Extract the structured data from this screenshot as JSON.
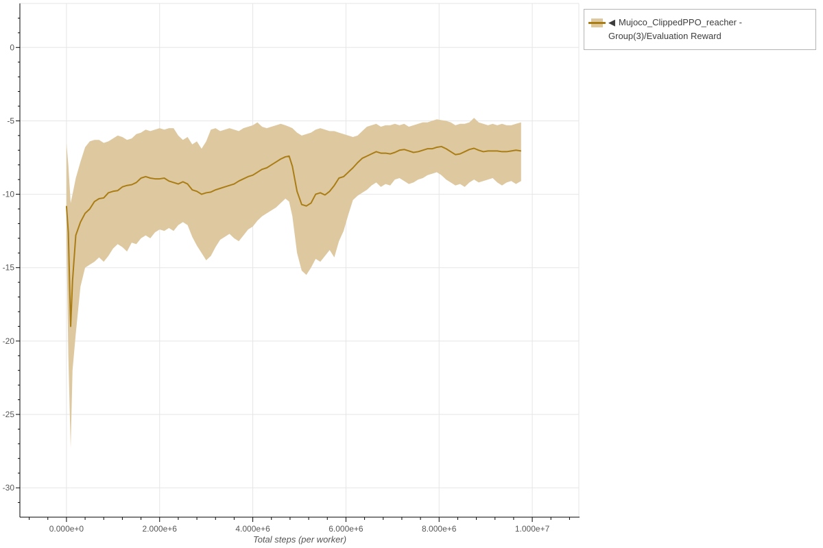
{
  "chart_data": {
    "type": "line",
    "title": "",
    "xlabel": "Total steps (per worker)",
    "ylabel": "",
    "grid": true,
    "x_scale": 1000000,
    "x_axis": {
      "range_millions": [
        -1,
        11
      ],
      "major_ticks_millions": [
        0,
        2,
        4,
        6,
        8,
        10
      ],
      "tick_labels": [
        "0.000e+0",
        "2.000e+6",
        "4.000e+6",
        "6.000e+6",
        "8.000e+6",
        "1.000e+7"
      ],
      "minor_step_millions": 0.4
    },
    "y_axis": {
      "range": [
        -32,
        3
      ],
      "major_ticks": [
        0,
        -5,
        -10,
        -15,
        -20,
        -25,
        -30
      ],
      "tick_labels": [
        "0",
        "-5",
        "-10",
        "-15",
        "-20",
        "-25",
        "-30"
      ],
      "minor_step": 1
    },
    "legend": {
      "position": "top-right-outside",
      "marker": "◀",
      "label": "Mujoco_ClippedPPO_reacher - Group(3)/Evaluation Reward"
    },
    "colors": {
      "line": "#aa7d14",
      "band": "#dec8a0",
      "grid": "#e5e5e5",
      "axis": "#000000",
      "tick_label": "#555555",
      "legend_border": "#b3b3b3",
      "legend_text": "#3c3c3c"
    },
    "series": [
      {
        "name": "Mujoco_ClippedPPO_reacher - Group(3)/Evaluation Reward",
        "x_millions": [
          0,
          0.04,
          0.09,
          0.13,
          0.2,
          0.3,
          0.4,
          0.5,
          0.6,
          0.7,
          0.8,
          0.9,
          1.0,
          1.1,
          1.2,
          1.3,
          1.4,
          1.5,
          1.6,
          1.7,
          1.8,
          1.9,
          2.0,
          2.1,
          2.2,
          2.3,
          2.4,
          2.5,
          2.6,
          2.7,
          2.8,
          2.9,
          3.0,
          3.1,
          3.2,
          3.3,
          3.4,
          3.5,
          3.6,
          3.7,
          3.8,
          3.9,
          4.0,
          4.1,
          4.2,
          4.3,
          4.4,
          4.5,
          4.6,
          4.7,
          4.78,
          4.85,
          4.95,
          5.05,
          5.15,
          5.25,
          5.35,
          5.45,
          5.55,
          5.65,
          5.75,
          5.85,
          5.95,
          6.05,
          6.15,
          6.25,
          6.35,
          6.45,
          6.55,
          6.65,
          6.75,
          6.85,
          6.95,
          7.05,
          7.15,
          7.25,
          7.35,
          7.45,
          7.55,
          7.65,
          7.75,
          7.85,
          7.95,
          8.05,
          8.15,
          8.25,
          8.35,
          8.45,
          8.55,
          8.65,
          8.75,
          8.85,
          8.95,
          9.05,
          9.15,
          9.25,
          9.35,
          9.45,
          9.55,
          9.65,
          9.76
        ],
        "mean": [
          -10.8,
          -12.6,
          -19.0,
          -15.9,
          -12.8,
          -11.9,
          -11.3,
          -11.0,
          -10.5,
          -10.3,
          -10.25,
          -9.9,
          -9.8,
          -9.75,
          -9.5,
          -9.4,
          -9.35,
          -9.2,
          -8.9,
          -8.8,
          -8.9,
          -8.95,
          -8.95,
          -8.9,
          -9.1,
          -9.2,
          -9.3,
          -9.15,
          -9.3,
          -9.7,
          -9.8,
          -10.0,
          -9.9,
          -9.85,
          -9.7,
          -9.6,
          -9.5,
          -9.4,
          -9.3,
          -9.1,
          -8.95,
          -8.8,
          -8.7,
          -8.5,
          -8.3,
          -8.2,
          -8.0,
          -7.8,
          -7.6,
          -7.45,
          -7.4,
          -8.1,
          -9.8,
          -10.7,
          -10.8,
          -10.6,
          -10.0,
          -9.9,
          -10.05,
          -9.8,
          -9.4,
          -8.9,
          -8.8,
          -8.5,
          -8.2,
          -7.85,
          -7.55,
          -7.4,
          -7.25,
          -7.1,
          -7.2,
          -7.2,
          -7.25,
          -7.15,
          -7.0,
          -6.95,
          -7.05,
          -7.15,
          -7.1,
          -7.0,
          -6.9,
          -6.9,
          -6.8,
          -6.75,
          -6.9,
          -7.1,
          -7.3,
          -7.25,
          -7.1,
          -6.95,
          -6.87,
          -7.0,
          -7.1,
          -7.05,
          -7.05,
          -7.05,
          -7.1,
          -7.1,
          -7.05,
          -7.0,
          -7.05
        ],
        "hi": [
          -6.5,
          -8.0,
          -10.6,
          -10.0,
          -8.9,
          -7.8,
          -6.8,
          -6.4,
          -6.3,
          -6.3,
          -6.5,
          -6.4,
          -6.2,
          -6.0,
          -6.1,
          -6.3,
          -6.2,
          -5.9,
          -5.8,
          -5.6,
          -5.7,
          -5.6,
          -5.5,
          -5.6,
          -5.5,
          -5.5,
          -6.0,
          -6.3,
          -6.1,
          -6.6,
          -6.4,
          -6.9,
          -6.4,
          -5.6,
          -5.5,
          -5.7,
          -5.6,
          -5.5,
          -5.6,
          -5.7,
          -5.5,
          -5.4,
          -5.3,
          -5.1,
          -5.4,
          -5.5,
          -5.4,
          -5.3,
          -5.2,
          -5.3,
          -5.4,
          -5.5,
          -5.8,
          -6.0,
          -5.9,
          -5.8,
          -5.6,
          -5.5,
          -5.6,
          -5.7,
          -5.7,
          -5.8,
          -5.9,
          -6.0,
          -6.1,
          -6.0,
          -5.7,
          -5.4,
          -5.3,
          -5.2,
          -5.4,
          -5.3,
          -5.3,
          -5.2,
          -5.3,
          -5.2,
          -5.4,
          -5.3,
          -5.2,
          -5.1,
          -5.1,
          -5.0,
          -4.9,
          -4.95,
          -5.0,
          -5.1,
          -5.3,
          -5.2,
          -5.2,
          -5.1,
          -4.8,
          -5.1,
          -5.2,
          -5.3,
          -5.2,
          -5.3,
          -5.2,
          -5.3,
          -5.3,
          -5.2,
          -5.1
        ],
        "lo": [
          -13.0,
          -21.0,
          -27.3,
          -22.0,
          -19.5,
          -16.3,
          -15.0,
          -14.8,
          -14.6,
          -14.3,
          -14.6,
          -14.2,
          -13.7,
          -13.4,
          -13.6,
          -13.9,
          -13.3,
          -13.4,
          -13.0,
          -12.8,
          -13.0,
          -12.6,
          -12.4,
          -12.5,
          -12.3,
          -12.5,
          -12.1,
          -11.9,
          -12.1,
          -12.9,
          -13.5,
          -14.0,
          -14.5,
          -14.2,
          -13.6,
          -13.1,
          -12.9,
          -12.7,
          -13.0,
          -13.2,
          -12.8,
          -12.4,
          -12.2,
          -11.8,
          -11.5,
          -11.3,
          -11.1,
          -10.9,
          -10.6,
          -10.3,
          -10.5,
          -11.5,
          -14.0,
          -15.2,
          -15.5,
          -15.0,
          -14.4,
          -14.6,
          -14.2,
          -13.8,
          -14.3,
          -13.2,
          -12.5,
          -11.4,
          -10.4,
          -10.1,
          -9.9,
          -9.7,
          -9.4,
          -9.2,
          -9.5,
          -9.3,
          -9.4,
          -9.0,
          -8.9,
          -9.1,
          -9.3,
          -9.2,
          -9.0,
          -8.9,
          -8.7,
          -8.6,
          -8.5,
          -8.7,
          -9.0,
          -9.2,
          -9.4,
          -9.3,
          -9.5,
          -9.2,
          -9.0,
          -9.2,
          -9.1,
          -9.0,
          -8.9,
          -9.2,
          -9.4,
          -9.2,
          -9.1,
          -9.3,
          -9.1
        ]
      }
    ]
  }
}
